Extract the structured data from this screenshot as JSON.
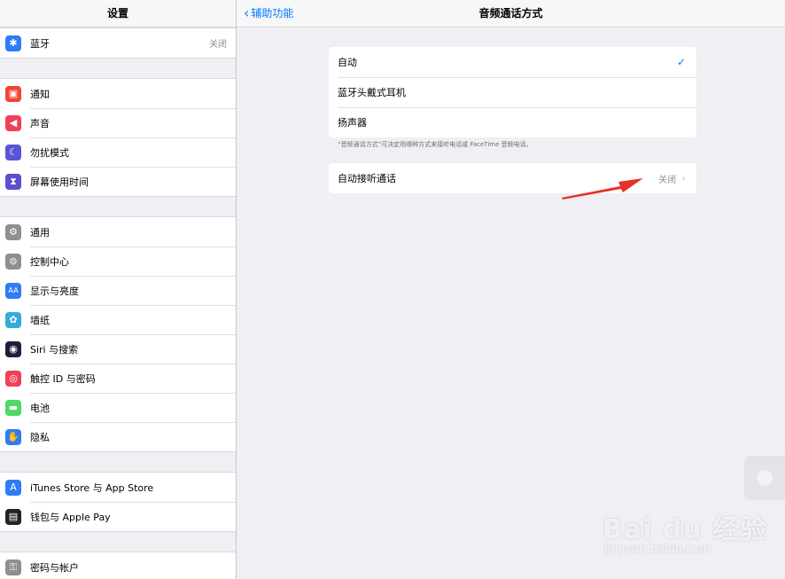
{
  "sidebar": {
    "title": "设置",
    "groups": [
      {
        "items": [
          {
            "label": "蓝牙",
            "value": "关闭",
            "icon": "bluetooth-icon",
            "color": "#2f7cf6",
            "glyph": "✱"
          }
        ]
      },
      {
        "items": [
          {
            "label": "通知",
            "icon": "notifications-icon",
            "color": "#f44336",
            "glyph": "▣"
          },
          {
            "label": "声音",
            "icon": "sound-icon",
            "color": "#f2405a",
            "glyph": "◀"
          },
          {
            "label": "勿扰模式",
            "icon": "moon-icon",
            "color": "#5856d6",
            "glyph": "☾"
          },
          {
            "label": "屏幕使用时间",
            "icon": "hourglass-icon",
            "color": "#5b4fcf",
            "glyph": "⧗"
          }
        ]
      },
      {
        "items": [
          {
            "label": "通用",
            "icon": "gear-icon",
            "color": "#8e8e93",
            "glyph": "⚙"
          },
          {
            "label": "控制中心",
            "icon": "control-center-icon",
            "color": "#8e8e93",
            "glyph": "⊜"
          },
          {
            "label": "显示与亮度",
            "icon": "display-icon",
            "color": "#2f7cf6",
            "glyph": "AA"
          },
          {
            "label": "墙纸",
            "icon": "wallpaper-icon",
            "color": "#35aadc",
            "glyph": "✿"
          },
          {
            "label": "Siri 与搜索",
            "icon": "siri-icon",
            "color": "#1f1f3a",
            "glyph": "◉"
          },
          {
            "label": "触控 ID 与密码",
            "icon": "fingerprint-icon",
            "color": "#f2405a",
            "glyph": "◎"
          },
          {
            "label": "电池",
            "icon": "battery-icon",
            "color": "#4cd964",
            "glyph": "▬"
          },
          {
            "label": "隐私",
            "icon": "hand-icon",
            "color": "#2f7cf6",
            "glyph": "✋"
          }
        ]
      },
      {
        "items": [
          {
            "label": "iTunes Store 与 App Store",
            "icon": "app-store-icon",
            "color": "#2f7cf6",
            "glyph": "A"
          },
          {
            "label": "钱包与 Apple Pay",
            "icon": "wallet-icon",
            "color": "#222222",
            "glyph": "▤"
          }
        ]
      },
      {
        "items": [
          {
            "label": "密码与帐户",
            "icon": "key-icon",
            "color": "#8e8e93",
            "glyph": "⚿"
          }
        ]
      }
    ]
  },
  "nav": {
    "back_label": "辅助功能",
    "title": "音频通话方式"
  },
  "options": [
    {
      "label": "自动",
      "checked": true
    },
    {
      "label": "蓝牙头戴式耳机",
      "checked": false
    },
    {
      "label": "扬声器",
      "checked": false
    }
  ],
  "check_glyph": "✓",
  "footnote": "“音频通话方式”可决定用哪种方式来接听电话或 FaceTime 音频电话。",
  "auto_answer": {
    "label": "自动接听通话",
    "value": "关闭"
  },
  "watermark": {
    "text": "Bai du 经验",
    "sub": "jingyan.baidu.com"
  },
  "colors": {
    "accent": "#007aff",
    "arrow": "#e8302a"
  }
}
